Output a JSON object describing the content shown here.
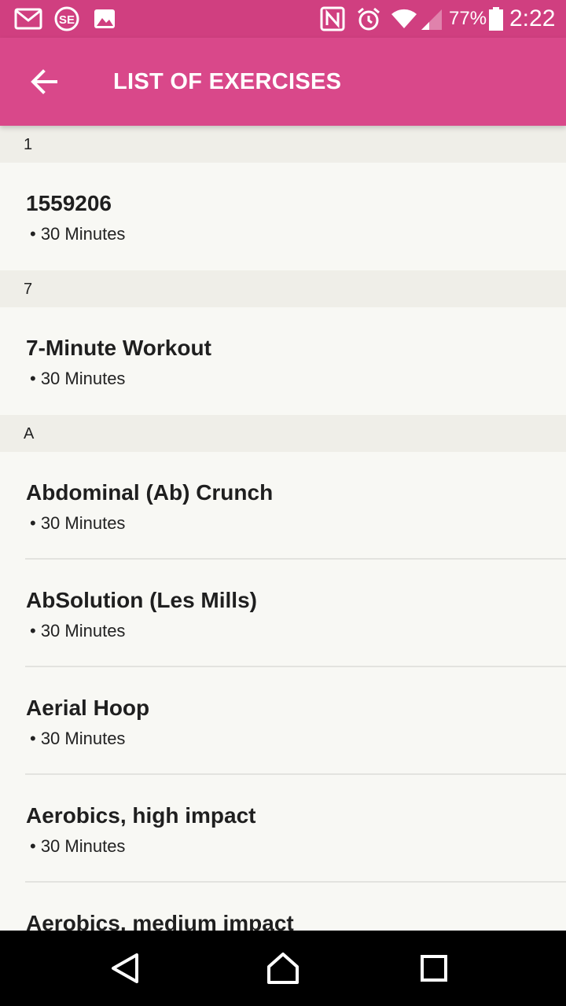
{
  "status_bar": {
    "icons": [
      "gmail-icon",
      "se-app-icon",
      "image-icon",
      "nfc-icon",
      "alarm-icon",
      "wifi-icon",
      "signal-icon",
      "battery-icon"
    ],
    "battery": "77%",
    "time": "2:22"
  },
  "app_bar": {
    "title": "LIST OF EXERCISES",
    "back_icon": "arrow-back-icon"
  },
  "sections": [
    {
      "header": "1",
      "items": [
        {
          "name": "1559206",
          "duration": "• 30 Minutes"
        }
      ]
    },
    {
      "header": "7",
      "items": [
        {
          "name": "7-Minute Workout",
          "duration": "• 30 Minutes"
        }
      ]
    },
    {
      "header": "A",
      "items": [
        {
          "name": "Abdominal (Ab) Crunch",
          "duration": "• 30 Minutes"
        },
        {
          "name": "AbSolution (Les Mills)",
          "duration": "• 30 Minutes"
        },
        {
          "name": "Aerial Hoop",
          "duration": "• 30 Minutes"
        },
        {
          "name": "Aerobics, high impact",
          "duration": "• 30 Minutes"
        },
        {
          "name": "Aerobics, medium impact",
          "duration": ""
        }
      ]
    }
  ],
  "nav_bar": {
    "buttons": [
      "back-triangle-icon",
      "home-icon",
      "recents-icon"
    ]
  },
  "colors": {
    "status_bar": "#d03f80",
    "app_bar": "#d9488a",
    "section_header_bg": "#efeee8",
    "list_bg": "#f8f8f4"
  }
}
